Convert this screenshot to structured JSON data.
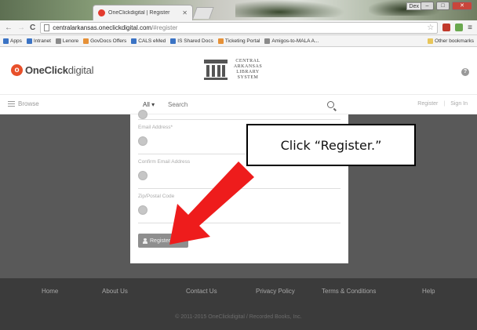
{
  "browser": {
    "tab_title": "OneClickdigital | Register",
    "url_host": "centralarkansas.oneclickdigital.com",
    "url_path": "/#register",
    "user_chip": "Dex",
    "bookmarks": [
      {
        "label": "Apps",
        "icon": "apps-icon"
      },
      {
        "label": "Intranet",
        "icon": "bookmark-icon"
      },
      {
        "label": "Lenore",
        "icon": "bookmark-icon"
      },
      {
        "label": "GovDocs Offers",
        "icon": "bookmark-icon"
      },
      {
        "label": "CALS eMed",
        "icon": "bookmark-icon"
      },
      {
        "label": "IS Shared Docs",
        "icon": "bookmark-icon"
      },
      {
        "label": "Ticketing Portal",
        "icon": "bookmark-icon"
      },
      {
        "label": "Amigos-to-MALA A...",
        "icon": "bookmark-icon"
      }
    ],
    "other_bookmarks": "Other bookmarks"
  },
  "header": {
    "logo_prefix": "OneClick",
    "logo_suffix": "digital",
    "library_name": "CENTRAL ARKANSAS LIBRARY SYSTEM",
    "help_label": "?"
  },
  "nav": {
    "browse_label": "Browse",
    "all_label": "All ▾",
    "search_placeholder": "Search",
    "register_link": "Register",
    "sign_in_link": "Sign In",
    "separator": "|"
  },
  "form": {
    "fields": [
      {
        "label": ""
      },
      {
        "label": "Email Address*"
      },
      {
        "label": "Confirm Email Address"
      },
      {
        "label": "Zip/Postal Code"
      }
    ],
    "register_button": "Register"
  },
  "callout": {
    "text": "Click “Register.”"
  },
  "footer": {
    "links": [
      "Home",
      "About Us",
      "Contact Us",
      "Privacy Policy",
      "Terms & Conditions",
      "Help"
    ],
    "copyright": "© 2011-2015 OneClickdigital / Recorded Books, Inc."
  },
  "colors": {
    "brand_orange": "#e8502a",
    "band_gray": "#595959",
    "footer_gray": "#3b3b3b",
    "arrow_red": "#ee1c1c"
  }
}
